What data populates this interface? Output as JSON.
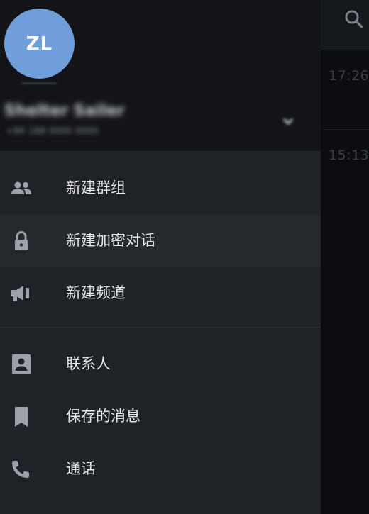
{
  "background": {
    "times": [
      "17:26",
      "15:13"
    ]
  },
  "header": {
    "avatar_initials": "ZL",
    "name_blurred": "Shelter Sailer",
    "subtitle_blurred": "+86 188 0000 0000"
  },
  "menu": {
    "items": [
      {
        "label": "新建群组",
        "icon": "group-icon"
      },
      {
        "label": "新建加密对话",
        "icon": "lock-icon"
      },
      {
        "label": "新建频道",
        "icon": "megaphone-icon"
      },
      {
        "label": "联系人",
        "icon": "contact-icon"
      },
      {
        "label": "保存的消息",
        "icon": "bookmark-icon"
      },
      {
        "label": "通话",
        "icon": "phone-icon"
      }
    ]
  },
  "colors": {
    "avatar": "#6f9edb",
    "drawer_bg": "#1f2226",
    "header_bg": "#121418",
    "text": "#e6e8eb",
    "icon": "#9ca2a9"
  }
}
